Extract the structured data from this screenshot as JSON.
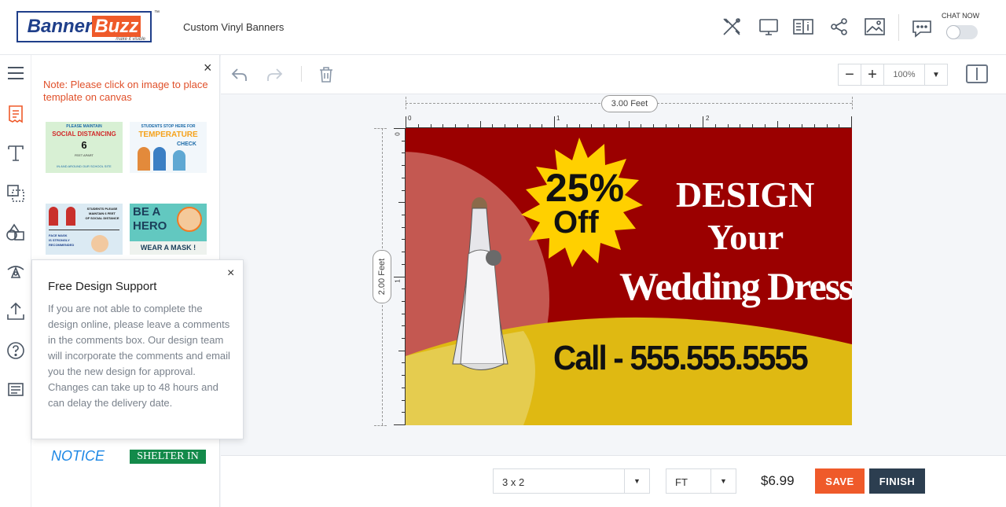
{
  "header": {
    "logo": {
      "part1": "Banner",
      "part2": "Buzz",
      "tagline": "make it visible",
      "tm": "™"
    },
    "product_title": "Custom Vinyl Banners",
    "icons": [
      "design-tools-icon",
      "desktop-preview-icon",
      "guide-book-icon",
      "share-icon",
      "image-gallery-icon",
      "chat-icon"
    ],
    "chat_label": "CHAT NOW"
  },
  "sidebar": {
    "items": [
      "menu-icon",
      "templates-icon",
      "text-icon",
      "clipart-icon",
      "shapes-icon",
      "background-icon",
      "upload-icon",
      "help-icon",
      "comments-icon"
    ]
  },
  "template_panel": {
    "close": "×",
    "note": "Note: Please click on image to place template on canvas",
    "templates": [
      {
        "line1": "PLEASE MAINTAIN",
        "line2": "SOCIAL DISTANCING",
        "line3": "6",
        "line4": "FEET APART",
        "line5": "IN AND AROUND OUR SCHOOL SITE"
      },
      {
        "line1": "STUDENTS STOP HERE FOR",
        "line2": "TEMPERATURE",
        "line3": "CHECK"
      },
      {
        "line1": "STUDENTS PLEASE",
        "line2": "MAINTAIN 6 FEET",
        "line3": "OF SOCIAL DISTANCE",
        "line4": "FACE MASK",
        "line5": "IS STRONGLY",
        "line6": "RECOMMENDED"
      },
      {
        "line1": "BE A",
        "line2": "HERO",
        "line3": "WEAR A MASK !"
      }
    ],
    "notice": "NOTICE",
    "shelter": "SHELTER IN"
  },
  "support_popup": {
    "title": "Free Design Support",
    "close": "×",
    "body": "If you are not able to complete the design online, please leave a comments in the comments box. Our design team will incorporate the comments and email you the new design for approval. Changes can take up to 48 hours and can delay the delivery date."
  },
  "toolbar": {
    "zoom_minus": "−",
    "zoom_plus": "+",
    "zoom_value": "100%",
    "zoom_dropdown": "▼"
  },
  "rulers": {
    "width_label": "3.00 Feet",
    "height_label": "2.00 Feet",
    "h_labels": [
      "0",
      "1",
      "2"
    ],
    "v_labels": [
      "0",
      "1"
    ]
  },
  "banner": {
    "badge_line1": "25%",
    "badge_line2": "Off",
    "headline1": "DESIGN",
    "headline2": "Your",
    "headline3": "Wedding Dress",
    "phone": "Call - 555.555.5555",
    "colors": {
      "background": "#9b0000",
      "yellow": "#dfb912",
      "badge": "#ffd000"
    }
  },
  "bottom": {
    "size_value": "3 x 2",
    "unit_value": "FT",
    "price": "$6.99",
    "save_label": "SAVE",
    "finish_label": "FINISH",
    "arrow": "▼"
  }
}
